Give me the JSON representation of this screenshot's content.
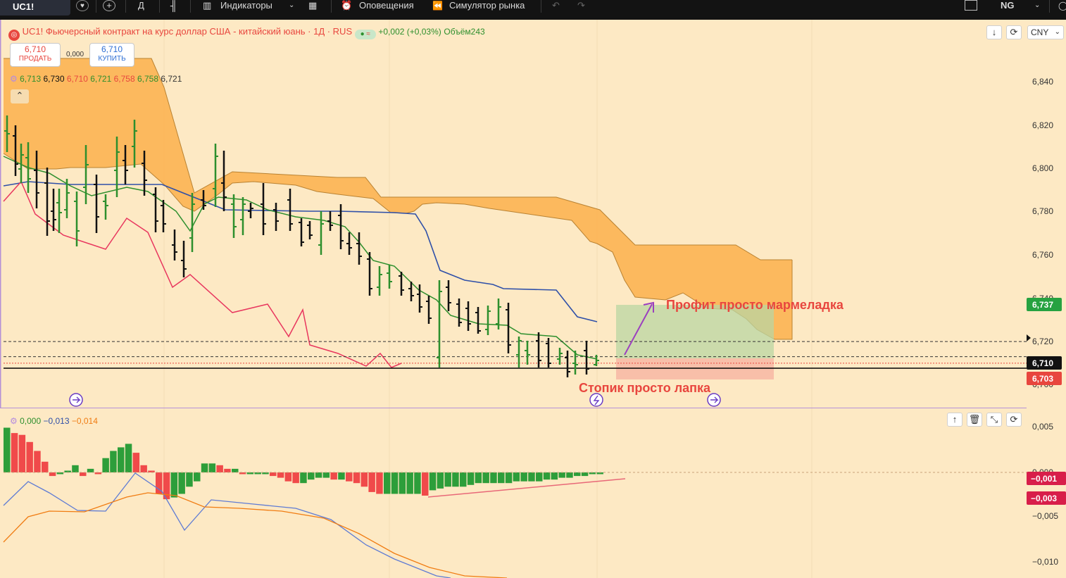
{
  "toolbar": {
    "symbol": "UC1!",
    "interval": "Д",
    "indicators": "Индикаторы",
    "alerts": "Оповещения",
    "replay": "Симулятор рынка",
    "layout_name": "NG"
  },
  "header": {
    "symbol": "UC1!",
    "description": "Фьючерсный контракт на курс доллар США - китайский юань · 1Д · RUS",
    "change": "+0,002 (+0,03%)",
    "volume": "Объём243",
    "currency": "CNY",
    "sell_price": "6,710",
    "sell_label": "ПРОДАТЬ",
    "spread": "0,000",
    "buy_price": "6,710",
    "buy_label": "КУПИТЬ"
  },
  "ichimoku_legend": {
    "values": [
      "6,713",
      "6,730",
      "6,710",
      "6,721",
      "6,758",
      "6,758",
      "6,721"
    ],
    "colors": [
      "#2d8f2d",
      "#111111",
      "#e8463e",
      "#2d8f2d",
      "#e8463e",
      "#2d8f2d",
      "#333333"
    ]
  },
  "macd_legend": {
    "values": [
      "0,000",
      "−0,013",
      "−0,014"
    ],
    "colors": [
      "#2d8f2d",
      "#2e4fa8",
      "#f07c12"
    ]
  },
  "price_axis": {
    "ticks": [
      "6,840",
      "6,820",
      "6,800",
      "6,780",
      "6,760",
      "6,740",
      "6,720",
      "6,700"
    ],
    "badges": [
      {
        "value": "6,737",
        "color": "#26a241"
      },
      {
        "value": "6,710",
        "color": "#111111"
      },
      {
        "value": "6,703",
        "color": "#e8463e"
      }
    ]
  },
  "macd_axis": {
    "ticks": [
      "0,005",
      "0,000",
      "−0,005",
      "−0,010"
    ],
    "badges": [
      {
        "value": "−0,001",
        "color": "#d81e4a"
      },
      {
        "value": "−0,003",
        "color": "#d81e4a"
      }
    ]
  },
  "annotations": {
    "profit": "Профит просто мармеладка",
    "stop": "Стопик просто лапка"
  },
  "colors": {
    "background": "#fde9c4",
    "cloud": "#fbb04c",
    "kijun": "#2e4fa8",
    "tenkan": "#2d8f2d",
    "chikou": "#e8463e",
    "bar_up": "#2d8f2d",
    "bar_down": "#111111",
    "hist_up": "#2d9e3a",
    "hist_down": "#f04a4a",
    "macd_line": "#5e7bd4",
    "signal_line": "#f07c12",
    "annotation": "#e8463e",
    "profit_zone": "#b9d6a3",
    "stop_zone": "#f7b7a5"
  }
}
